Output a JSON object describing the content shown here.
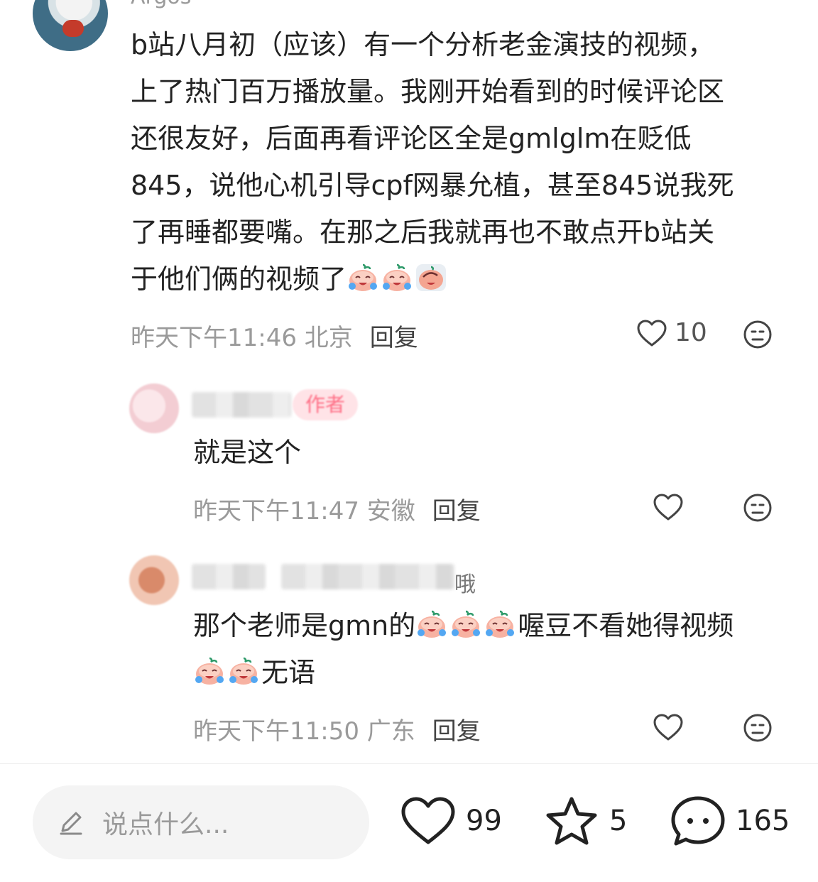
{
  "comments": [
    {
      "username": "Argos",
      "text_lines": [
        "b站八月初（应该）有一个分析老金演技的视频，",
        "上了热门百万播放量。我刚开始看到的时候评论区",
        "还很友好，后面再看评论区全是gmlglm在贬低",
        "845，说他心机引导cpf网暴允植，甚至845说我死",
        "了再睡都要嘴。在那之后我就再也不敢点开b站关",
        "于他们俩的视频了"
      ],
      "time": "昨天下午11:46 北京",
      "reply_label": "回复",
      "likes": "10"
    },
    {
      "author_tag": "作者",
      "text_lines": [
        "就是这个"
      ],
      "time": "昨天下午11:47 安徽",
      "reply_label": "回复",
      "likes": ""
    },
    {
      "name_suffix": "哦",
      "text_line1_a": "那个老师是gmn的",
      "text_line1_b": "喔豆不看她得视频",
      "text_line2": "无语",
      "time": "昨天下午11:50 广东",
      "reply_label": "回复",
      "likes": ""
    }
  ],
  "bottom_bar": {
    "input_placeholder": "说点什么...",
    "like_count": "99",
    "star_count": "5",
    "comment_count": "165"
  },
  "icons": {
    "like": "heart-outline-icon",
    "dislike": "neutral-face-icon",
    "star": "star-outline-icon",
    "comment": "speech-bubble-icon",
    "edit": "pencil-icon",
    "emoji": "crying-peach-emoji"
  },
  "colors": {
    "text": "#222222",
    "meta": "#9a9a9a",
    "author_tag_bg": "#ffe3e7",
    "author_tag_text": "#ff6f86"
  }
}
